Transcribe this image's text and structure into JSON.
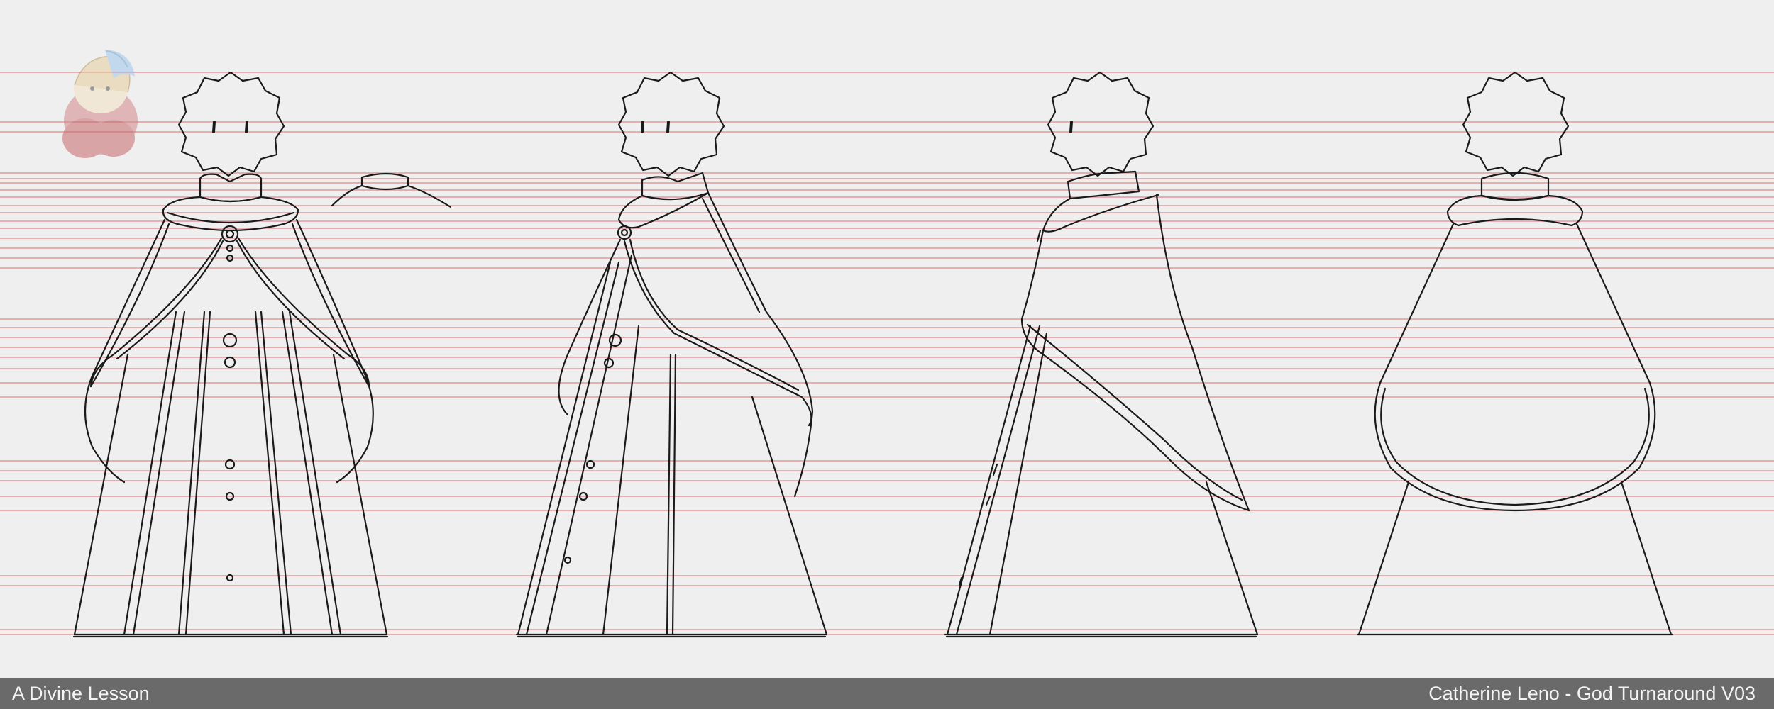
{
  "footer": {
    "left_text": "A Divine Lesson",
    "right_text": "Catherine Leno - God Turnaround V03"
  },
  "sheet": {
    "guide_line_color": "#e58a8a",
    "line_art_color": "#1a1a1a",
    "background_color": "#efefef",
    "footer_color": "#6a6a6a",
    "views": [
      "front",
      "three-quarter",
      "side",
      "back"
    ],
    "reference_thumbnail": "character-portrait"
  }
}
